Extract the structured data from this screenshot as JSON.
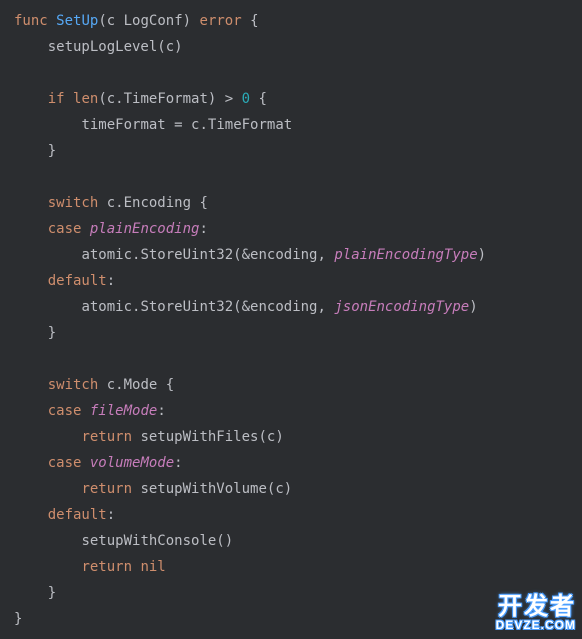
{
  "code": {
    "l1": {
      "kw_func": "func",
      "name": "SetUp",
      "lp": "(",
      "param": "c",
      "sp": " ",
      "ptype": "LogConf",
      "rp": ")",
      "sp2": " ",
      "ret": "error",
      "sp3": " ",
      "lb": "{"
    },
    "l2": {
      "indent": "    ",
      "call": "setupLogLevel",
      "lp": "(",
      "arg": "c",
      "rp": ")"
    },
    "l3": {
      "blank": ""
    },
    "l4": {
      "indent": "    ",
      "kw_if": "if",
      "sp": " ",
      "call": "len",
      "lp": "(",
      "arg": "c.TimeFormat",
      "rp": ")",
      "sp2": " ",
      "op": ">",
      "sp3": " ",
      "num": "0",
      "sp4": " ",
      "lb": "{"
    },
    "l5": {
      "indent": "        ",
      "lhs": "timeFormat",
      "sp": " ",
      "op": "=",
      "sp2": " ",
      "rhs": "c.TimeFormat"
    },
    "l6": {
      "indent": "    ",
      "rb": "}"
    },
    "l7": {
      "blank": ""
    },
    "l8": {
      "indent": "    ",
      "kw_switch": "switch",
      "sp": " ",
      "expr": "c.Encoding",
      "sp2": " ",
      "lb": "{"
    },
    "l9": {
      "indent": "    ",
      "kw_case": "case",
      "sp": " ",
      "val": "plainEncoding",
      "colon": ":"
    },
    "l10": {
      "indent": "        ",
      "obj": "atomic",
      "dot": ".",
      "method": "StoreUint32",
      "lp": "(",
      "amp": "&",
      "arg1": "encoding",
      "comma": ",",
      "sp": " ",
      "arg2": "plainEncodingType",
      "rp": ")"
    },
    "l11": {
      "indent": "    ",
      "kw_default": "default",
      "colon": ":"
    },
    "l12": {
      "indent": "        ",
      "obj": "atomic",
      "dot": ".",
      "method": "StoreUint32",
      "lp": "(",
      "amp": "&",
      "arg1": "encoding",
      "comma": ",",
      "sp": " ",
      "arg2": "jsonEncodingType",
      "rp": ")"
    },
    "l13": {
      "indent": "    ",
      "rb": "}"
    },
    "l14": {
      "blank": ""
    },
    "l15": {
      "indent": "    ",
      "kw_switch": "switch",
      "sp": " ",
      "expr": "c.Mode",
      "sp2": " ",
      "lb": "{"
    },
    "l16": {
      "indent": "    ",
      "kw_case": "case",
      "sp": " ",
      "val": "fileMode",
      "colon": ":"
    },
    "l17": {
      "indent": "        ",
      "kw_return": "return",
      "sp": " ",
      "call": "setupWithFiles",
      "lp": "(",
      "arg": "c",
      "rp": ")"
    },
    "l18": {
      "indent": "    ",
      "kw_case": "case",
      "sp": " ",
      "val": "volumeMode",
      "colon": ":"
    },
    "l19": {
      "indent": "        ",
      "kw_return": "return",
      "sp": " ",
      "call": "setupWithVolume",
      "lp": "(",
      "arg": "c",
      "rp": ")"
    },
    "l20": {
      "indent": "    ",
      "kw_default": "default",
      "colon": ":"
    },
    "l21": {
      "indent": "        ",
      "call": "setupWithConsole",
      "lp": "(",
      "rp": ")"
    },
    "l22": {
      "indent": "        ",
      "kw_return": "return",
      "sp": " ",
      "kw_nil": "nil"
    },
    "l23": {
      "indent": "    ",
      "rb": "}"
    },
    "l24": {
      "rb": "}"
    }
  },
  "watermark": {
    "cn": "开发者",
    "url": "DEVZE.COM"
  }
}
